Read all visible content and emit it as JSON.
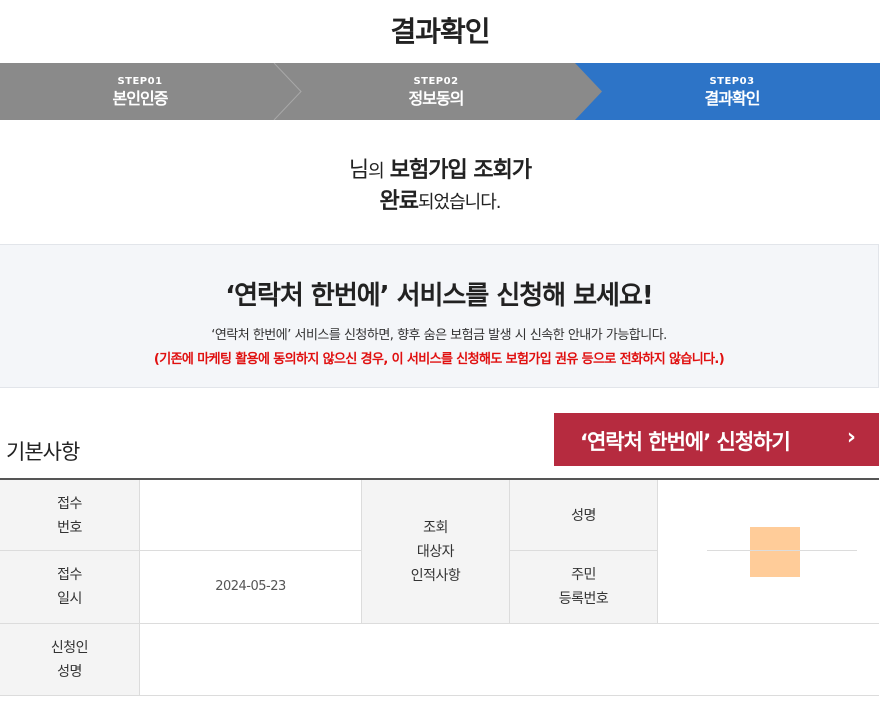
{
  "page_title": "결과확인",
  "steps": [
    {
      "num": "STEP01",
      "name": "본인인증"
    },
    {
      "num": "STEP02",
      "name": "정보동의"
    },
    {
      "num": "STEP03",
      "name": "결과확인"
    }
  ],
  "colors": {
    "step_inactive": "#8a8a8a",
    "step_active": "#2d74c7",
    "apply_button": "#b62b3f",
    "warning_text": "#e01010"
  },
  "result_message": {
    "line1_suffix": "님",
    "line1_particle": "의",
    "line1_bold": "보험가입 조회가",
    "line2_bold": "완료",
    "line2_rest": "되었습니다."
  },
  "promo": {
    "title": "‘연락처 한번에’ 서비스를 신청해 보세요!",
    "description": "‘연락처 한번에’ 서비스를 신청하면, 향후 숨은 보험금 발생 시 신속한 안내가 가능합니다.",
    "warning": "(기존에 마케팅 활용에 동의하지 않으신 경우, 이 서비스를 신청해도 보험가입 권유 등으로 전화하지 않습니다.)"
  },
  "section_title": "기본사항",
  "apply_button": {
    "label": "‘연락처 한번에’ 신청하기",
    "icon": "chevron-right-icon"
  },
  "info_table": {
    "receipt_no_label": "접수\n번호",
    "receipt_no_value": "",
    "receipt_date_label": "접수\n일시",
    "receipt_date_value": "2024-05-23",
    "applicant_name_label": "신청인\n성명",
    "applicant_name_value": "",
    "target_label": "조회\n대상자\n인적사항",
    "name_label": "성명",
    "resident_no_label": "주민\n등록번호"
  }
}
